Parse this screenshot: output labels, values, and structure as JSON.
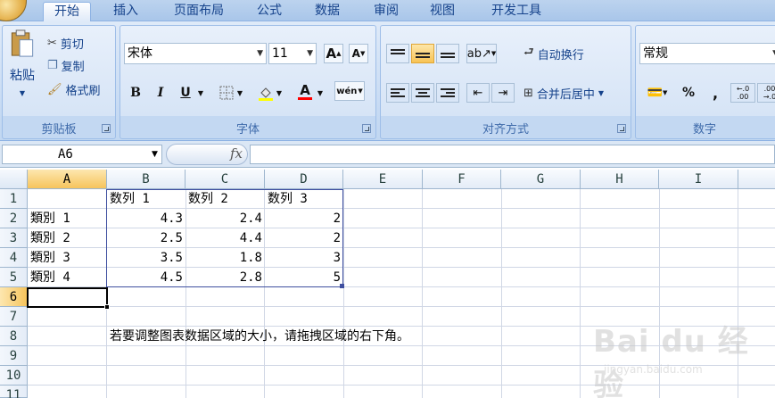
{
  "tabs": [
    {
      "label": "开始",
      "active": true
    },
    {
      "label": "插入"
    },
    {
      "label": "页面布局"
    },
    {
      "label": "公式"
    },
    {
      "label": "数据"
    },
    {
      "label": "审阅"
    },
    {
      "label": "视图"
    },
    {
      "label": "开发工具"
    }
  ],
  "clipboard": {
    "group_label": "剪贴板",
    "paste": "粘贴",
    "cut": "剪切",
    "copy": "复制",
    "format_painter": "格式刷"
  },
  "font": {
    "group_label": "字体",
    "font_name": "宋体",
    "font_size": "11",
    "bold": "B",
    "italic": "I",
    "underline": "U",
    "grow": "A",
    "shrink": "A",
    "font_color_letter": "A",
    "phonetic": "wén"
  },
  "alignment": {
    "group_label": "对齐方式",
    "wrap_text": "自动换行",
    "merge_center": "合并后居中"
  },
  "number": {
    "group_label": "数字",
    "format": "常规",
    "percent": "%",
    "comma": ",",
    "increase_decimal": "←.0 .00",
    "decrease_decimal": ".00 →.0"
  },
  "formula_bar": {
    "name_box": "A6",
    "fx": "fx",
    "formula": ""
  },
  "sheet": {
    "columns": [
      "A",
      "B",
      "C",
      "D",
      "E",
      "F",
      "G",
      "H",
      "I"
    ],
    "rows": [
      "1",
      "2",
      "3",
      "4",
      "5",
      "6",
      "7",
      "8",
      "9",
      "10",
      "11"
    ],
    "cells": {
      "B1": "数列 1",
      "C1": "数列 2",
      "D1": "数列 3",
      "A2": "類別 1",
      "B2": "4.3",
      "C2": "2.4",
      "D2": "2",
      "A3": "類別 2",
      "B3": "2.5",
      "C3": "4.4",
      "D3": "2",
      "A4": "類別 3",
      "B4": "3.5",
      "C4": "1.8",
      "D4": "3",
      "A5": "類別 4",
      "B5": "4.5",
      "C5": "2.8",
      "D5": "5",
      "B8": "若要调整图表数据区域的大小，请拖拽区域的右下角。"
    }
  },
  "watermark": {
    "text": "Bai du 经验",
    "url": "jingyan.baidu.com"
  },
  "colors": {
    "ribbon_bg": "#c6daf3",
    "group_label": "#3e6aaa",
    "selection_header": "#f6c45c",
    "range_border": "#3f4fa0"
  }
}
